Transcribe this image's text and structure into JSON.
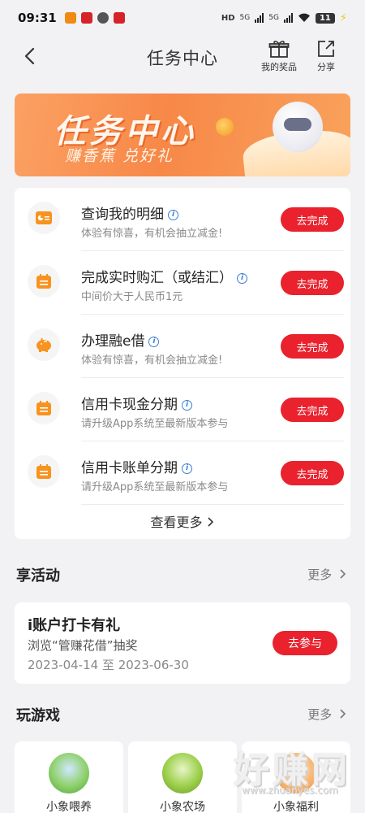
{
  "status_bar": {
    "time": "09:31",
    "network1": "5G",
    "network2": "5G",
    "battery": "11"
  },
  "nav": {
    "title": "任务中心",
    "prizes_label": "我的奖品",
    "share_label": "分享"
  },
  "banner": {
    "title": "任务中心",
    "subtitle": "赚香蕉 兑好礼"
  },
  "tasks": [
    {
      "title": "查询我的明细",
      "desc": "体验有惊喜，有机会抽立减金!",
      "button": "去完成",
      "icon": "chart-card-icon"
    },
    {
      "title": "完成实时购汇（或结汇）",
      "desc": "中间价大于人民币1元",
      "button": "去完成",
      "icon": "calendar-icon"
    },
    {
      "title": "办理融e借",
      "desc": "体验有惊喜，有机会抽立减金!",
      "button": "去完成",
      "icon": "piggy-bank-icon"
    },
    {
      "title": "信用卡现金分期",
      "desc": "请升级App系统至最新版本参与",
      "button": "去完成",
      "icon": "calendar-icon"
    },
    {
      "title": "信用卡账单分期",
      "desc": "请升级App系统至最新版本参与",
      "button": "去完成",
      "icon": "calendar-icon"
    }
  ],
  "task_see_more": "查看更多",
  "activities": {
    "heading": "享活动",
    "more": "更多",
    "item": {
      "title": "i账户打卡有礼",
      "desc": "浏览“管赚花借”抽奖",
      "date": "2023-04-14 至 2023-06-30",
      "button": "去参与"
    }
  },
  "games": {
    "heading": "玩游戏",
    "more": "更多",
    "items": [
      {
        "label": "小象喂养"
      },
      {
        "label": "小象农场"
      },
      {
        "label": "小象福利"
      }
    ]
  },
  "watermark": {
    "text": "好赚网",
    "url": "www.zhuanyes.com"
  },
  "colors": {
    "accent": "#e9222e",
    "icon_orange": "#f7931e",
    "info_blue": "#3b7ed6"
  }
}
